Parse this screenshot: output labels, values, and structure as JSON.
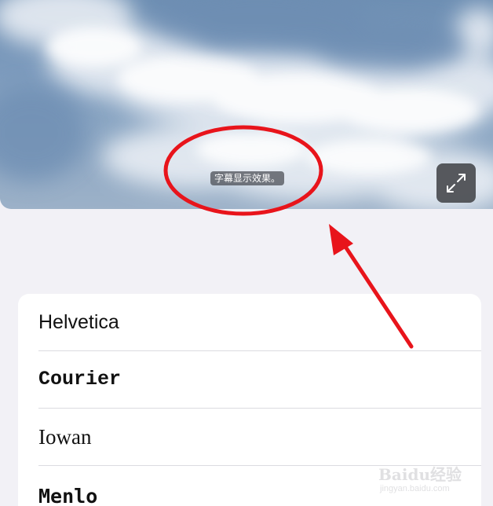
{
  "preview": {
    "caption": "字幕显示效果。",
    "fullscreen_icon": "expand-arrows-icon"
  },
  "font_list": {
    "items": [
      {
        "label": "Helvetica"
      },
      {
        "label": "Courier"
      },
      {
        "label": "Iowan"
      },
      {
        "label": "Menlo"
      }
    ]
  },
  "annotation": {
    "color": "#e8141b"
  },
  "watermark": {
    "brand": "Baidu经验",
    "url": "jingyan.baidu.com"
  }
}
